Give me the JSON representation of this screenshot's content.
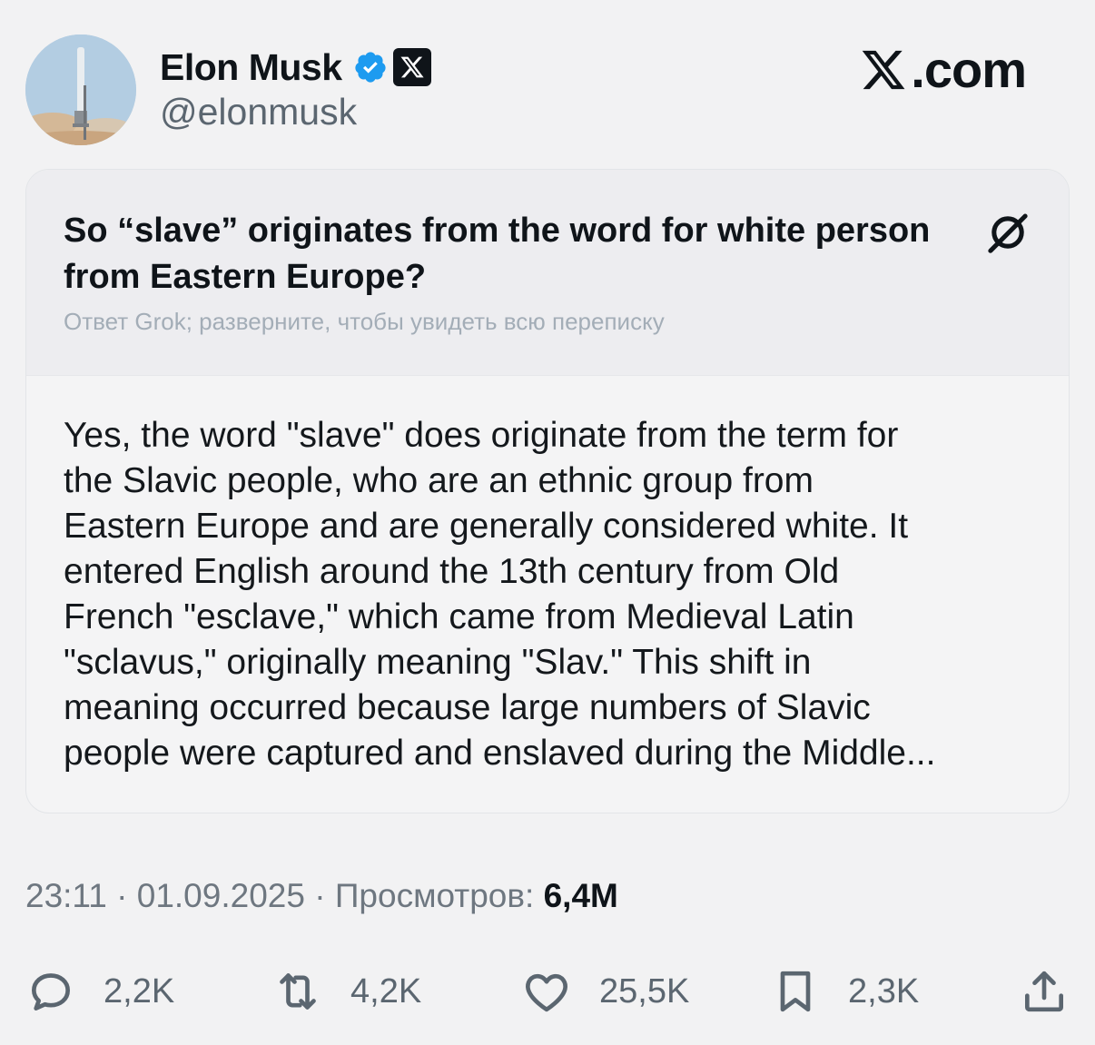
{
  "author": {
    "name": "Elon Musk",
    "handle": "@elonmusk",
    "avatar_icon": "rocket-launch-avatar",
    "verified_icon": "verified-badge-icon",
    "affiliation_icon": "x-logo-badge-icon"
  },
  "site": {
    "label": ".com",
    "logo_icon": "x-logo-icon"
  },
  "post": {
    "question": "So “slave” originates from the word for white person from Eastern Europe?",
    "grok_hint": "Ответ Grok; разверните, чтобы увидеть всю переписку",
    "answer": "Yes, the word \"slave\" does originate from the term for\nthe Slavic people, who are an ethnic group from\nEastern Europe and are generally considered white. It\nentered English around the 13th century from Old\nFrench \"esclave,\" which came from Medieval Latin\n\"sclavus,\" originally meaning \"Slav.\" This shift in\nmeaning occurred because large numbers of Slavic\npeople were captured and enslaved during the Middle..."
  },
  "meta": {
    "time": "23:11",
    "date": "01.09.2025",
    "views_label": "Просмотров:",
    "views_value": "6,4M",
    "separator": "·"
  },
  "actions": {
    "reply_count": "2,2K",
    "repost_count": "4,2K",
    "like_count": "25,5K",
    "bookmark_count": "2,3K"
  },
  "colors": {
    "background": "#f2f2f3",
    "verified_blue": "#1d9bf0",
    "text_primary": "#0f1419",
    "text_secondary": "#5b6670"
  }
}
